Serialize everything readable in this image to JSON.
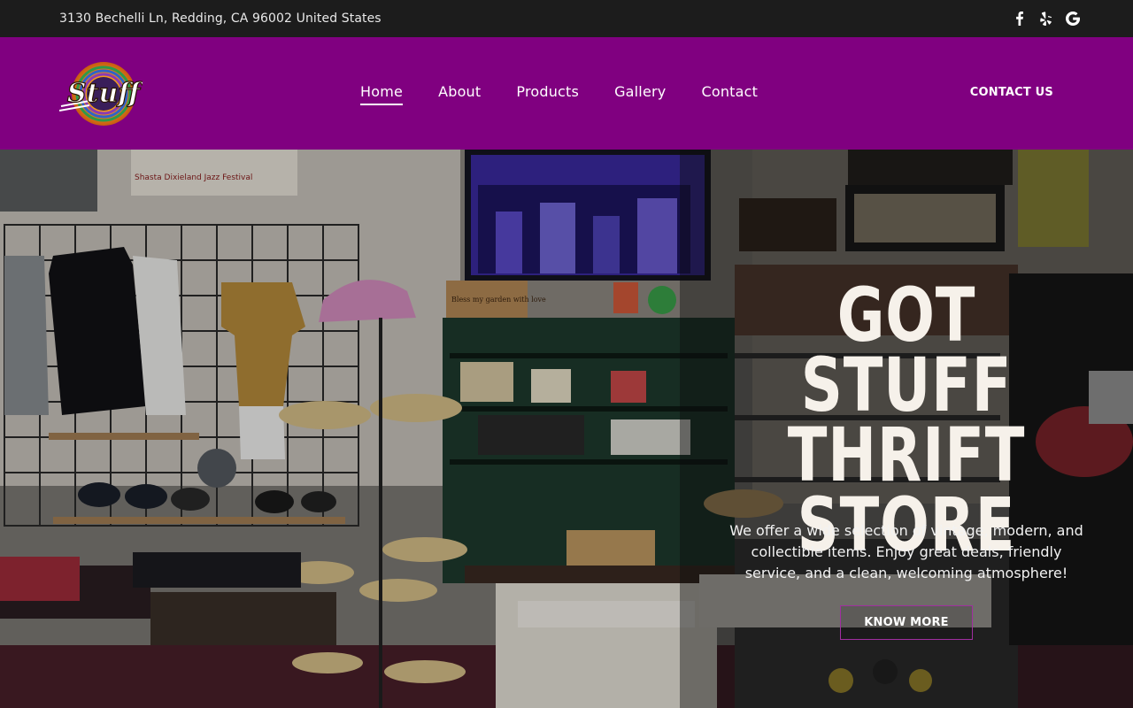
{
  "topbar": {
    "address": "3130 Bechelli Ln, Redding, CA 96002 United States",
    "socials": [
      {
        "icon": "facebook-icon"
      },
      {
        "icon": "yelp-icon"
      },
      {
        "icon": "google-icon"
      }
    ]
  },
  "header": {
    "logo_text": "Stuff",
    "nav": [
      {
        "label": "Home",
        "active": true
      },
      {
        "label": "About"
      },
      {
        "label": "Products"
      },
      {
        "label": "Gallery"
      },
      {
        "label": "Contact"
      }
    ],
    "cta_label": "CONTACT US"
  },
  "hero": {
    "title_lines": [
      "GOT STUFF",
      "THRIFT",
      "STORE"
    ],
    "description": "We offer a wide selection of vintage, modern, and collectible items. Enjoy great deals, friendly service, and a clean, welcoming atmosphere!",
    "button_label": "KNOW MORE",
    "photo_text": {
      "poster": "Shasta Dixieland Jazz Festival",
      "sign": "Bless my garden with love"
    }
  },
  "colors": {
    "topbar_bg": "#1c1c1c",
    "header_bg": "#800080",
    "accent_border": "#a02ea0",
    "title_color": "#f6f1ea"
  }
}
